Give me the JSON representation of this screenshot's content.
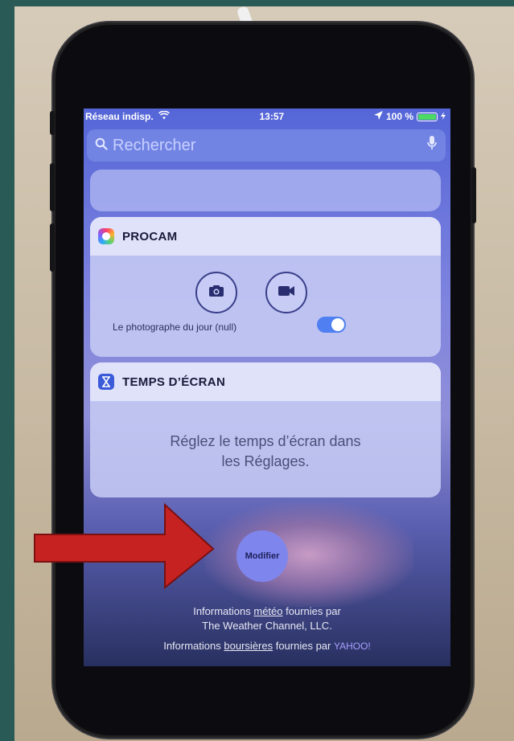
{
  "status_bar": {
    "carrier": "Réseau indisp.",
    "time": "13:57",
    "battery": "100 %"
  },
  "search": {
    "placeholder": "Rechercher"
  },
  "procam_widget": {
    "title": "PROCAM",
    "photo_label": "Le photographe du jour (null)",
    "toggle_on": true
  },
  "screen_time_widget": {
    "title": "TEMPS D’ÉCRAN",
    "message_line1": "Réglez le temps d’écran dans",
    "message_line2": "les Réglages."
  },
  "modifier_button": {
    "label": "Modifier"
  },
  "footer": {
    "weather_prefix": "Informations",
    "weather_link": "météo",
    "weather_suffix": "fournies par",
    "weather_provider": "The Weather Channel, LLC.",
    "stocks_prefix": "Informations",
    "stocks_link": "boursières",
    "stocks_suffix": "fournies par",
    "stocks_provider": "YAHOO!"
  },
  "colors": {
    "annotation_arrow": "#c62222",
    "toggle_on": "#4f7ff0",
    "battery_green": "#4cd964"
  }
}
